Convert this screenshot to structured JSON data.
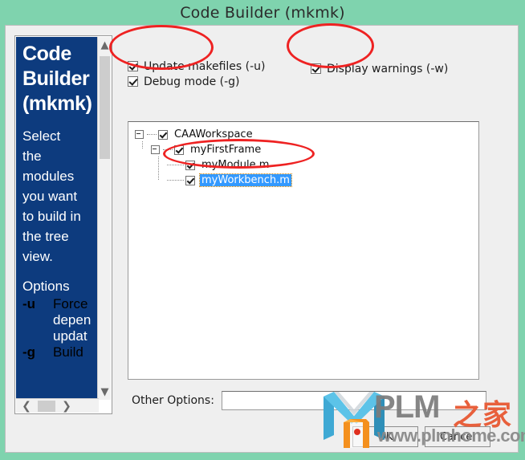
{
  "window": {
    "title": "Code Builder (mkmk)",
    "background_color": "#7fd3ae"
  },
  "help_panel": {
    "title_lines": [
      "Code",
      "Builder",
      "(mkmk)"
    ],
    "description_lines": [
      "Select",
      "the",
      "modules",
      "you want",
      "to build in",
      "the tree",
      "view."
    ],
    "options_heading": "Options",
    "options": [
      {
        "flag": "-u",
        "text_lines": [
          "Force",
          "depen",
          "updat"
        ]
      },
      {
        "flag": "-g",
        "text_lines": [
          "Build"
        ]
      }
    ],
    "scroll_up_icon": "chevron-up-icon",
    "scroll_down_icon": "chevron-down-icon",
    "scroll_left_icon": "chevron-left-icon",
    "scroll_right_icon": "chevron-right-icon",
    "background_color": "#0d3b7e",
    "text_color": "#ffffff"
  },
  "options": {
    "update_makefiles": {
      "label": "Update makefiles (-u)",
      "checked": true
    },
    "debug_mode": {
      "label": "Debug mode (-g)",
      "checked": true
    },
    "display_warnings": {
      "label": "Display warnings (-w)",
      "checked": true
    }
  },
  "tree": {
    "nodes": [
      {
        "label": "CAAWorkspace",
        "checked": true,
        "expanded": true,
        "level": 0,
        "selected": false
      },
      {
        "label": "myFirstFrame",
        "checked": true,
        "expanded": true,
        "level": 1,
        "selected": false
      },
      {
        "label": "myModule.m",
        "checked": true,
        "expanded": null,
        "level": 2,
        "selected": false
      },
      {
        "label": "myWorkbench.m",
        "checked": true,
        "expanded": null,
        "level": 2,
        "selected": true
      }
    ],
    "selection_color": "#3399ff"
  },
  "other_options": {
    "label": "Other Options:",
    "value": "",
    "placeholder": ""
  },
  "buttons": {
    "ok": "OK",
    "cancel": "Cancel"
  },
  "watermark": {
    "brand": "PLM",
    "brand_cn": "之家",
    "url": "www.plmhome.com",
    "logo_icon": "plm-house-logo-icon",
    "logo_blue": "#3fa9d4",
    "logo_orange": "#f4901e"
  },
  "annotations": {
    "color": "#ee2222",
    "shapes": [
      {
        "name": "annotation-ellipse-left-options"
      },
      {
        "name": "annotation-ellipse-display-warnings"
      },
      {
        "name": "annotation-ellipse-selected-node"
      }
    ]
  }
}
